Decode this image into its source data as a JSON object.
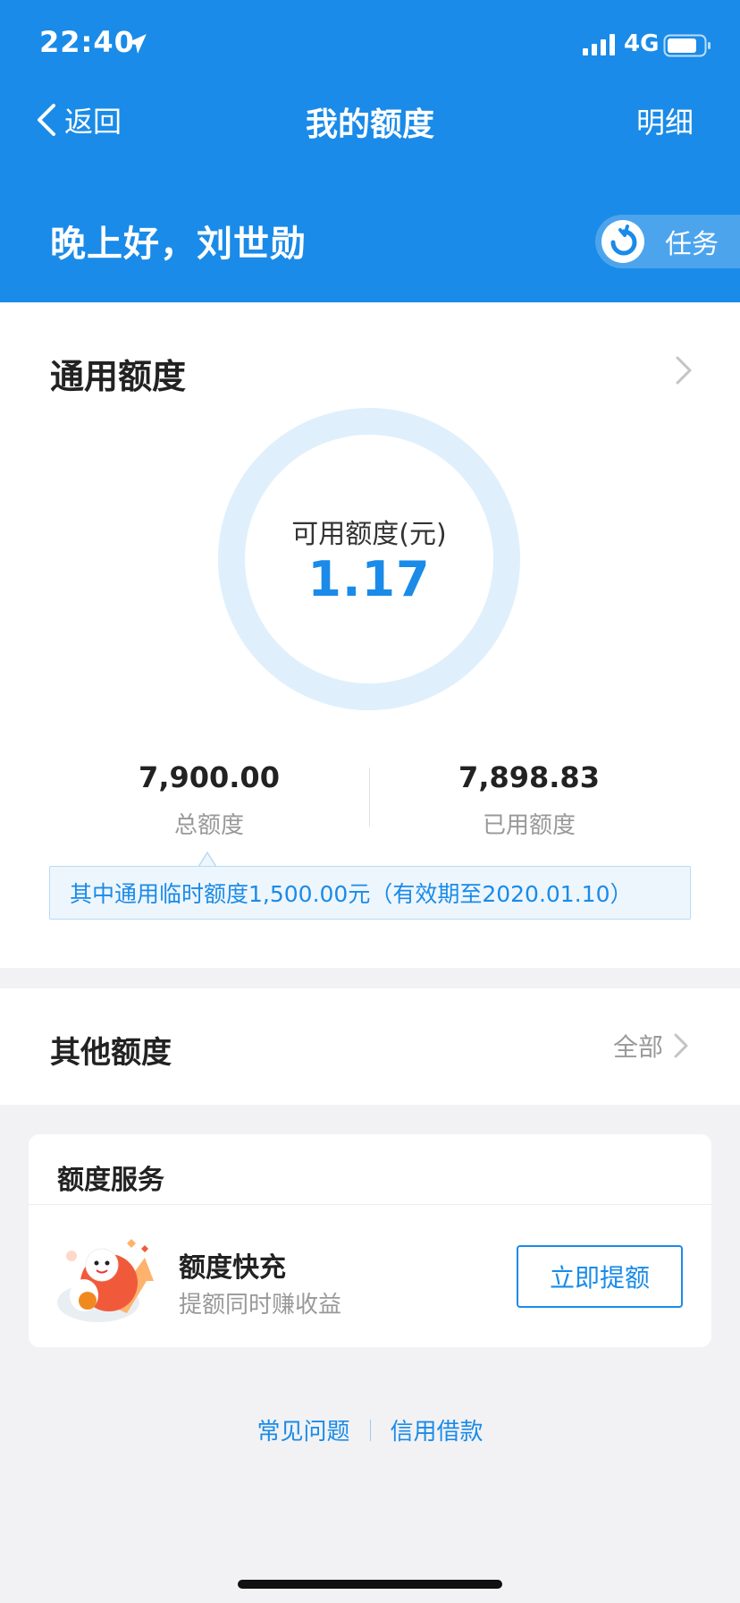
{
  "status_bar": {
    "time": "22:40",
    "network": "4G",
    "icons": [
      "location-arrow-icon",
      "signal-icon",
      "battery-icon"
    ]
  },
  "nav": {
    "back_label": "返回",
    "title": "我的额度",
    "detail_label": "明细"
  },
  "greeting": "晚上好，刘世勋",
  "task": {
    "label": "任务",
    "icon": "task-icon"
  },
  "general": {
    "title": "通用额度",
    "available_label": "可用额度(元)",
    "available_value": "1.17",
    "total_value": "7,900.00",
    "total_label": "总额度",
    "used_value": "7,898.83",
    "used_label": "已用额度",
    "notice": "其中通用临时额度1,500.00元（有效期至2020.01.10）"
  },
  "other": {
    "title": "其他额度",
    "all_label": "全部"
  },
  "service": {
    "title": "额度服务",
    "item_title": "额度快充",
    "item_subtitle": "提额同时赚收益",
    "button_label": "立即提额"
  },
  "footer": {
    "faq": "常见问题",
    "credit_loan": "信用借款"
  },
  "colors": {
    "primary": "#1a8be8",
    "ring": "#dff0fc",
    "notice_bg": "#eef6fd",
    "page_bg": "#f2f2f4"
  }
}
